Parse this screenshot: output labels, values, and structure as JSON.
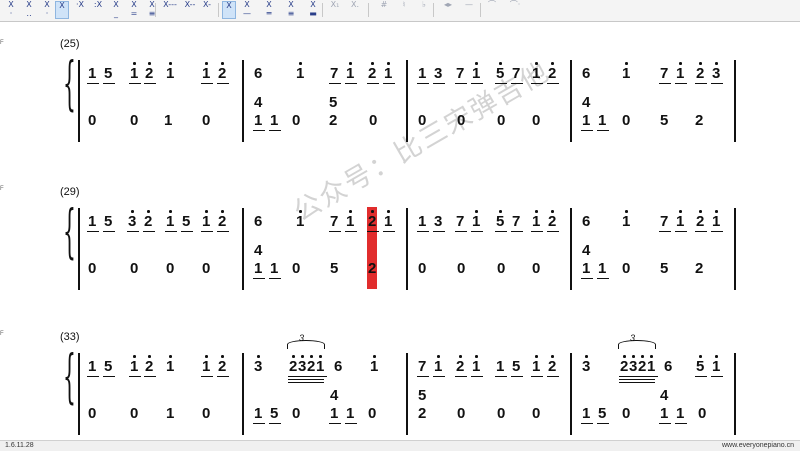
{
  "toolbar": {
    "buttons": [
      {
        "name": "tb-upper-dot-1",
        "top": "X",
        "bottom": "·",
        "state": "normal"
      },
      {
        "name": "tb-upper-dot-2",
        "top": "X",
        "bottom": "‥",
        "state": "normal"
      },
      {
        "name": "tb-lower-dot",
        "top": "X",
        "bottom": "·",
        "state": "normal"
      },
      {
        "name": "tb-note-x",
        "top": "X",
        "bottom": "",
        "state": "selected"
      },
      {
        "name": "tb-high-dot-1",
        "top": "·X",
        "bottom": "",
        "state": "normal"
      },
      {
        "name": "tb-high-dot-2",
        "top": ":X",
        "bottom": "",
        "state": "normal"
      },
      {
        "name": "tb-underline-1",
        "top": "X",
        "bottom": "_",
        "state": "normal"
      },
      {
        "name": "tb-underline-2",
        "top": "X",
        "bottom": "=",
        "state": "normal"
      },
      {
        "name": "tb-underline-3",
        "top": "X",
        "bottom": "≡",
        "state": "normal"
      },
      {
        "name": "tb-dash-3",
        "top": "X---",
        "bottom": "",
        "state": "normal"
      },
      {
        "name": "tb-dash-2",
        "top": "X--",
        "bottom": "",
        "state": "normal"
      },
      {
        "name": "tb-dash-1",
        "top": "X-",
        "bottom": "",
        "state": "normal"
      },
      {
        "name": "tb-note-x-2",
        "top": "X",
        "bottom": "",
        "state": "selected"
      },
      {
        "name": "tb-bar-1",
        "top": "X",
        "bottom": "—",
        "state": "normal"
      },
      {
        "name": "tb-bar-2",
        "top": "X",
        "bottom": "═",
        "state": "normal"
      },
      {
        "name": "tb-bar-3",
        "top": "X",
        "bottom": "≡",
        "state": "normal"
      },
      {
        "name": "tb-bar-4",
        "top": "X",
        "bottom": "▬",
        "state": "normal"
      },
      {
        "name": "tb-sub",
        "top": "X₁",
        "bottom": "",
        "state": "dim"
      },
      {
        "name": "tb-sub-2",
        "top": "X.",
        "bottom": "",
        "state": "dim"
      },
      {
        "name": "tb-sharp",
        "top": "#",
        "bottom": "",
        "state": "dim"
      },
      {
        "name": "tb-natural",
        "top": "♮",
        "bottom": "",
        "state": "dim"
      },
      {
        "name": "tb-flat",
        "top": "♭",
        "bottom": "",
        "state": "dim"
      },
      {
        "name": "tb-cresc",
        "top": "◂▸",
        "bottom": "",
        "state": "dim"
      },
      {
        "name": "tb-line",
        "top": "—",
        "bottom": "",
        "state": "dim"
      },
      {
        "name": "tb-slur",
        "top": "⌒",
        "bottom": "",
        "state": "dim"
      },
      {
        "name": "tb-tie",
        "top": "⌒·",
        "bottom": "",
        "state": "dim"
      }
    ]
  },
  "systems": [
    {
      "label": "(25)"
    },
    {
      "label": "(29)"
    },
    {
      "label": "(33)"
    }
  ],
  "watermark": "公众号：比三宋弹吉他",
  "status": {
    "version": "1.6.11.28",
    "site": "www.everyonepiano.cn"
  }
}
